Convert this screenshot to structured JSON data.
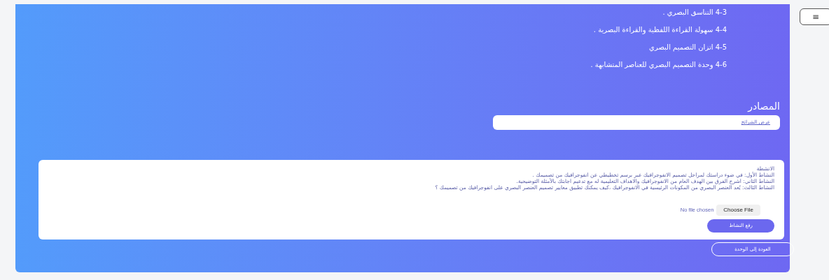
{
  "menu_button": {
    "label": "≡"
  },
  "topics": [
    "4-3 التناسق البصري .",
    "4-4 سهولة القراءة اللفظية والقراءة البصرية .",
    "4-5 اتزان التصميم البصري",
    "4-6 وحدة التصميم البصري للعناصر المتشابهة ."
  ],
  "sources": {
    "title": "المصادر",
    "link": "عرض الشرائح"
  },
  "activities": {
    "title": "الانشطة",
    "items": [
      "النشاط الأول: في ضوء دراستك لمراحل تصميم الانفوجرافيك عبر برسم تخطيطي عن انفوجرافيك من تصميمك .",
      "النشاط الثاني: اشرح الفرق بين الهدف العام من الانفوجرافيك والاهداف التعليمية له مع تدعيم اجابتك بالأمثلة التوضيحية.",
      "النشاط الثالث: يُعد العنصر البصري من المكونات الرئيسية في الانفوجرافيك ،كيف يمكنك تطبيق معايير تصميم العنصر البصري على انفوجرافيك من تصميمك ؟"
    ],
    "file_status": "No file chosen",
    "file_button": "Choose File",
    "upload_button": "رفع النشاط"
  },
  "back_button": "العودة إلى الوحدة"
}
